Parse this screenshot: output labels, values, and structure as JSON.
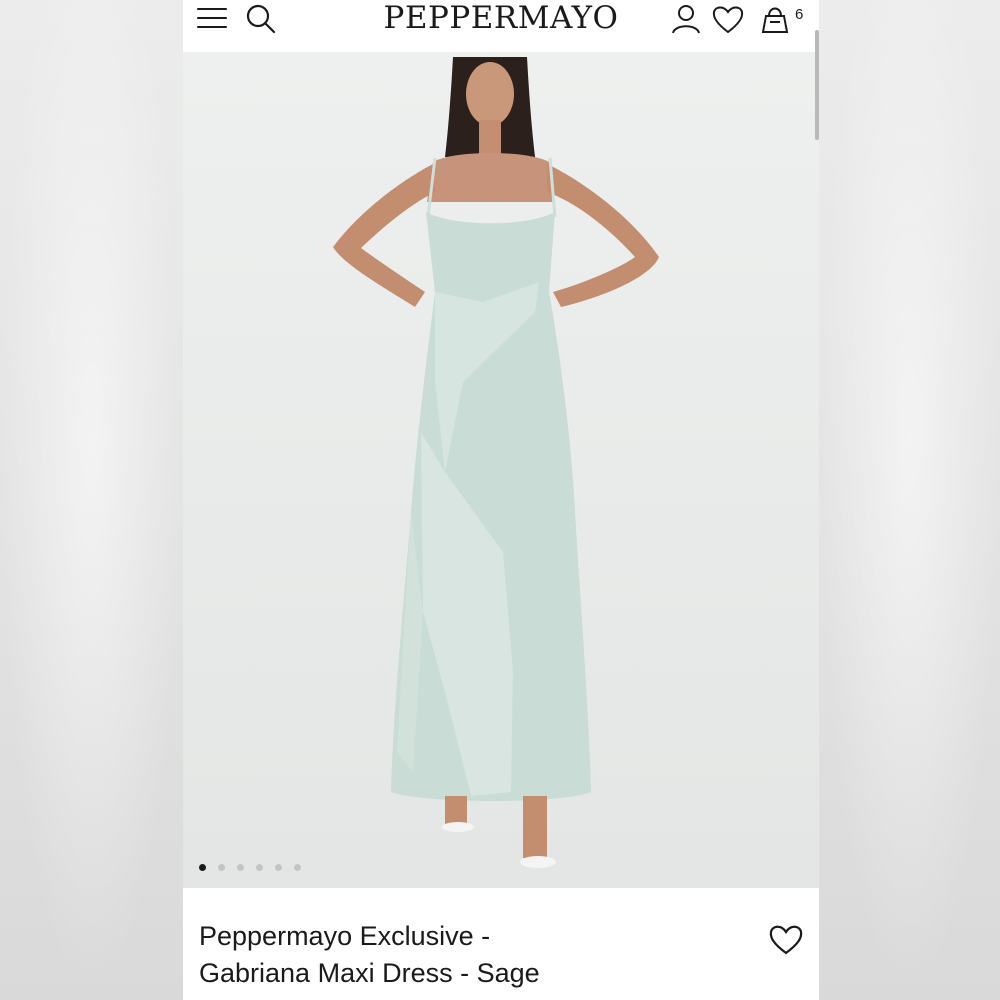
{
  "header": {
    "logo": "PEPPERMAYO",
    "cart_count": "6",
    "icons": [
      "menu-icon",
      "search-icon",
      "account-icon",
      "wishlist-icon",
      "bag-icon"
    ]
  },
  "gallery": {
    "slide_count": 6,
    "active_slide": 1
  },
  "product": {
    "title_line1": "Peppermayo Exclusive -",
    "title_line2": "Gabriana Maxi Dress - Sage",
    "wishlist_icon": "heart-icon"
  },
  "colors": {
    "text": "#1a1a1a",
    "dress": "#c9dcd6",
    "background": "#ffffff"
  }
}
